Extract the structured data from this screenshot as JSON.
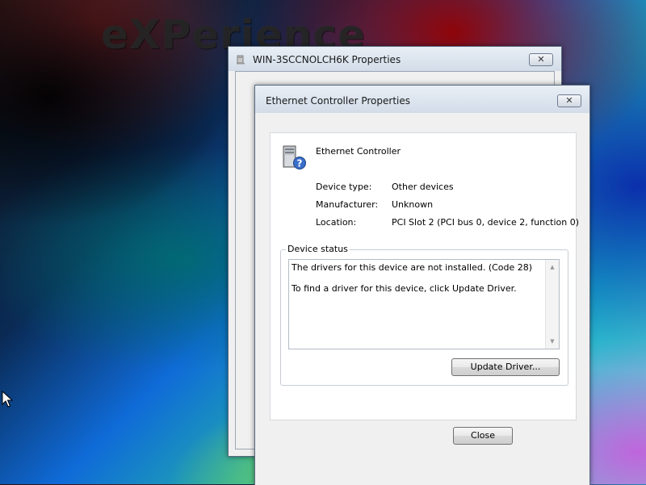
{
  "desktop": {
    "wallpaper_text": "eXPerience"
  },
  "main_window": {
    "title": "WIN-3SCCNOLCH6K Properties",
    "close_label": "✕",
    "icon": "computer-icon"
  },
  "dialog": {
    "title": "Ethernet Controller Properties",
    "close_label": "✕",
    "device_name": "Ethernet Controller",
    "device_icon": "unknown-device-icon",
    "properties": [
      {
        "label": "Device type:",
        "value": "Other devices"
      },
      {
        "label": "Manufacturer:",
        "value": "Unknown"
      },
      {
        "label": "Location:",
        "value": "PCI Slot 2 (PCI bus 0, device 2, function 0)"
      }
    ],
    "device_status": {
      "legend": "Device status",
      "lines": [
        "The drivers for this device are not installed. (Code 28)",
        "To find a driver for this device, click Update Driver."
      ]
    },
    "update_driver_label": "Update Driver...",
    "close_button_label": "Close"
  }
}
